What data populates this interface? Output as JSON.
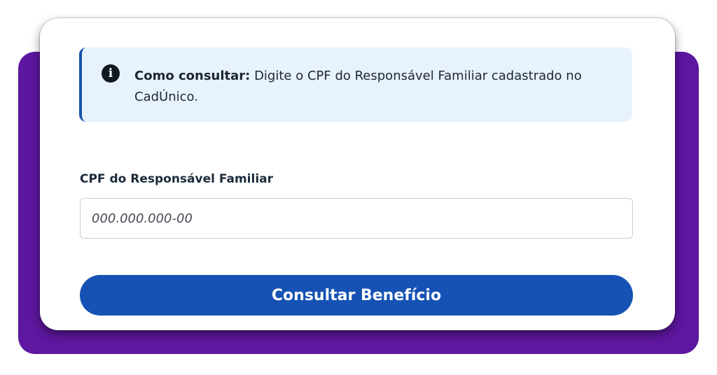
{
  "info": {
    "icon": "info-circle-icon",
    "title": "Como consultar:",
    "message": " Digite o CPF do Responsável Familiar cadastrado no CadÚnico."
  },
  "form": {
    "cpf_label": "CPF do Responsável Familiar",
    "cpf_placeholder": "000.000.000-00",
    "cpf_value": "",
    "submit_label": "Consultar Benefício"
  },
  "colors": {
    "backdrop_purple": "#5e17a0",
    "primary_blue": "#1552b3",
    "info_background": "#e8f2fd"
  }
}
